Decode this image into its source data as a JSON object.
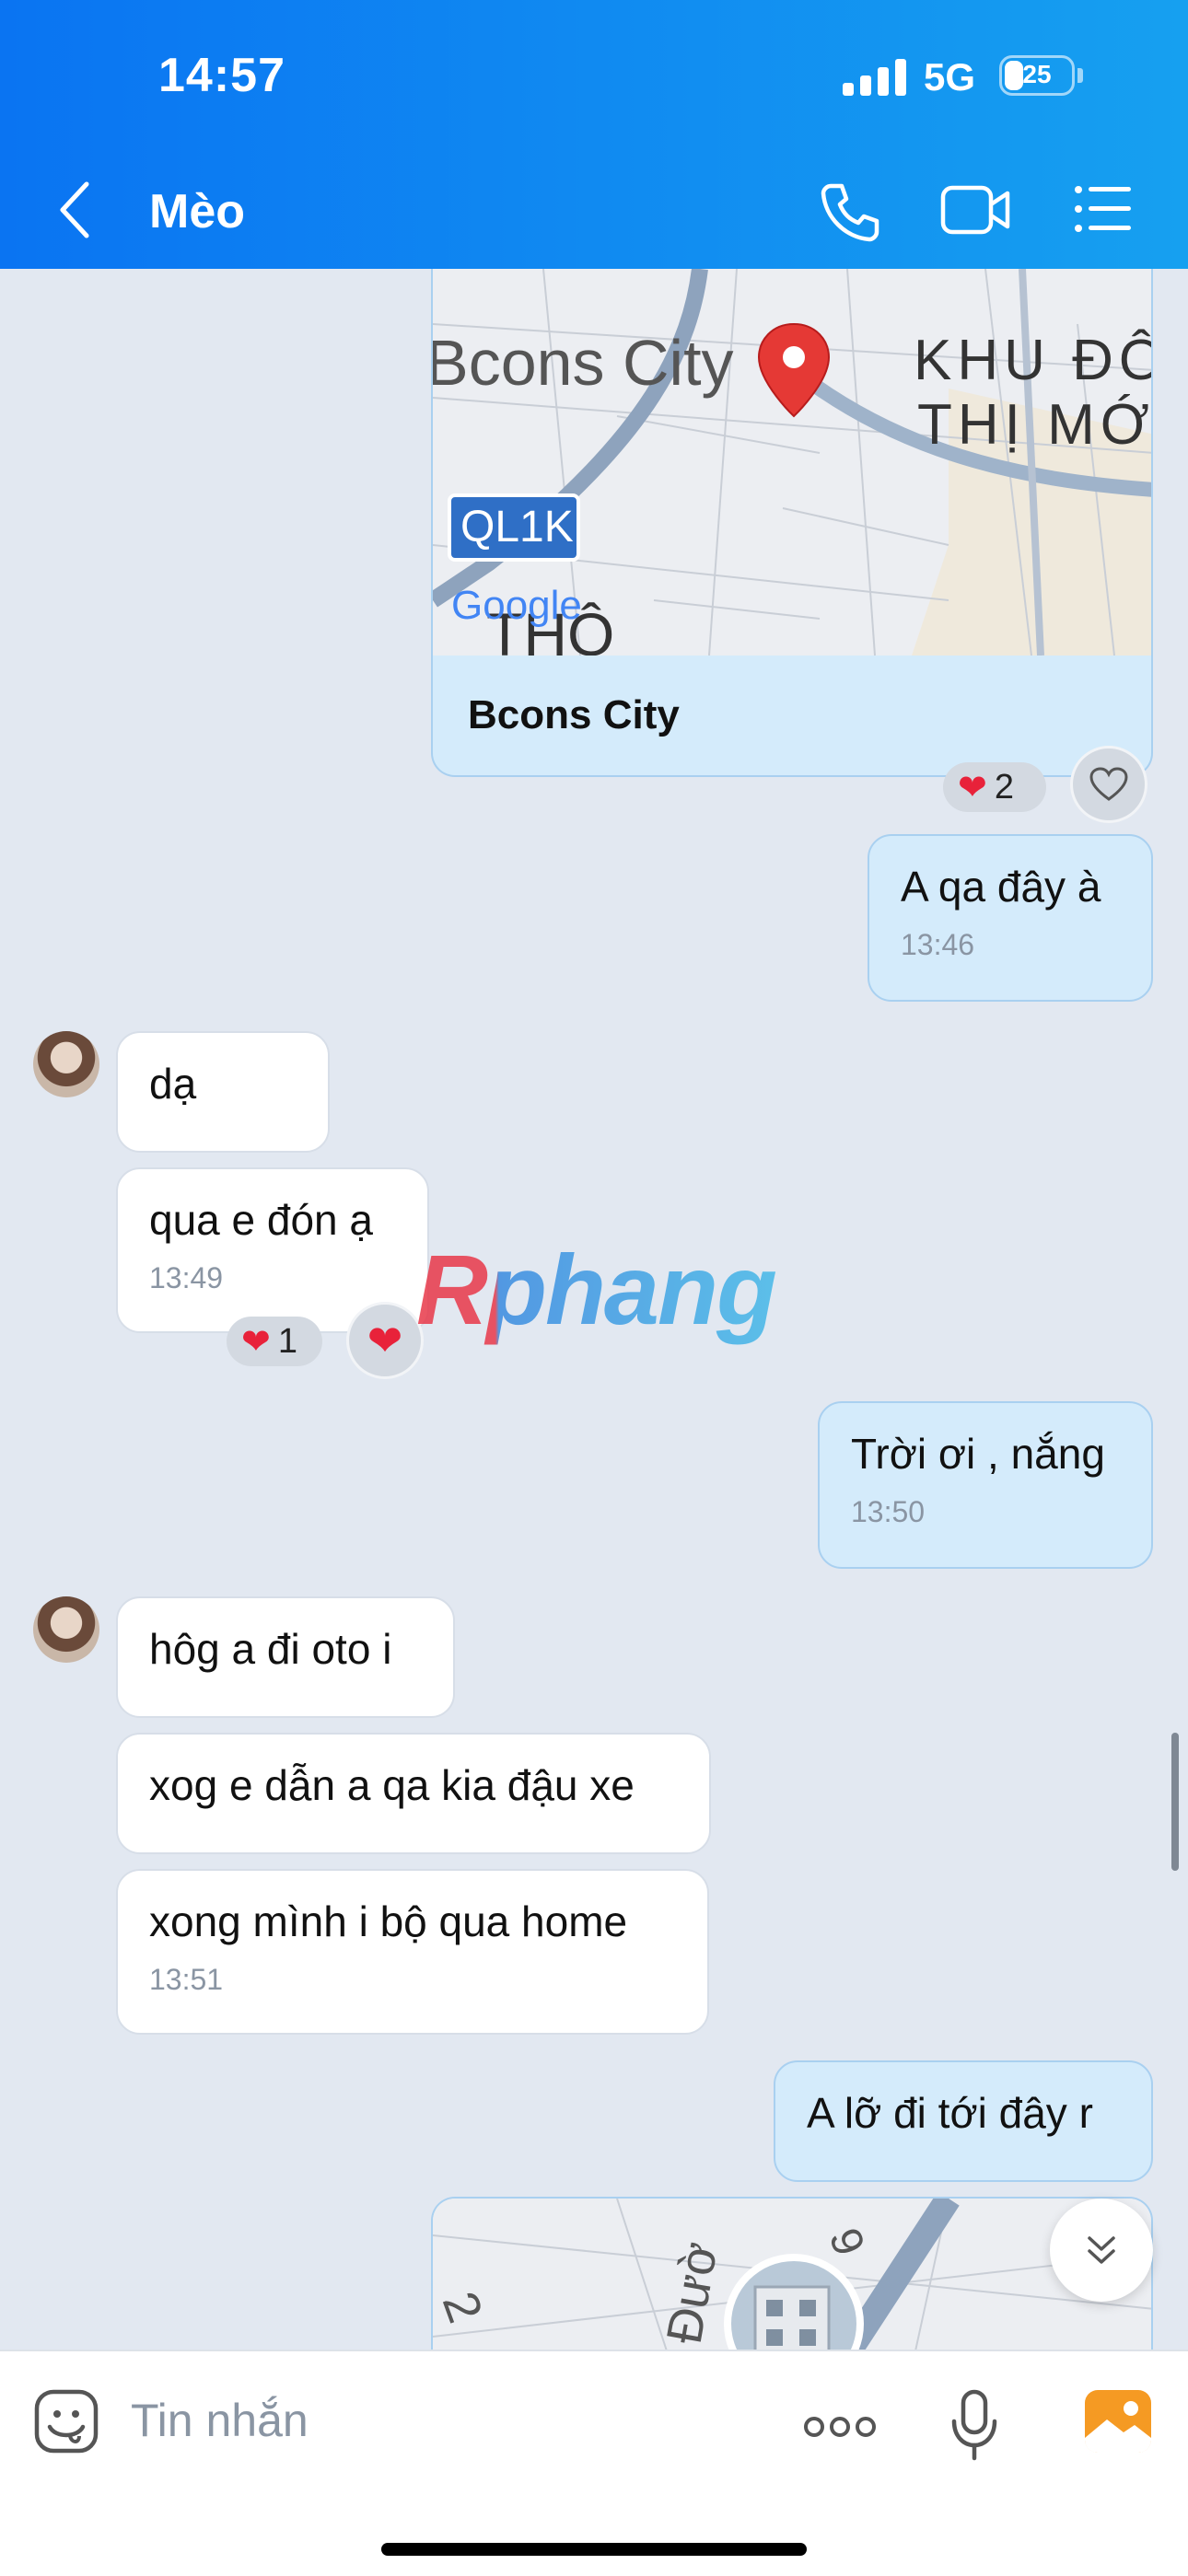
{
  "status_bar": {
    "time": "14:57",
    "network": "5G",
    "battery": "25"
  },
  "header": {
    "contact_name": "Mèo"
  },
  "map_card": {
    "title": "Bcons City",
    "labels": {
      "place": "Bcons City",
      "district_line1": "KHU ĐÔ",
      "district_line2": "THỊ MỚ",
      "road": "QL1K",
      "area": "THÔ",
      "brand": "Google"
    },
    "reaction_count": "2"
  },
  "messages": [
    {
      "dir": "out",
      "text": "A qa đây à",
      "time": "13:46"
    },
    {
      "dir": "in",
      "text": "dạ",
      "time": ""
    },
    {
      "dir": "in",
      "text": "qua e đón ạ",
      "time": "13:49",
      "reaction_count": "1"
    },
    {
      "dir": "out",
      "text": "Trời ơi , nắng",
      "time": "13:50"
    },
    {
      "dir": "in",
      "text": "hôg a đi oto i",
      "time": ""
    },
    {
      "dir": "in",
      "text": "xog e dẫn a qa kia đậu xe",
      "time": ""
    },
    {
      "dir": "in",
      "text": "xong mình i bộ qua home",
      "time": "13:51"
    },
    {
      "dir": "out",
      "text": "A lỡ đi tới đây r",
      "time": ""
    }
  ],
  "map2": {
    "street_label": "Đườ",
    "num_left": "2",
    "num_right": "9"
  },
  "watermark": "Rphang",
  "input": {
    "placeholder": "Tin nhắn"
  },
  "colors": {
    "header_start": "#0a74f2",
    "header_end": "#16a0f0",
    "outgoing_bubble": "#d4ebfb",
    "incoming_bubble": "#ffffff",
    "reaction_heart": "#e8223a"
  }
}
